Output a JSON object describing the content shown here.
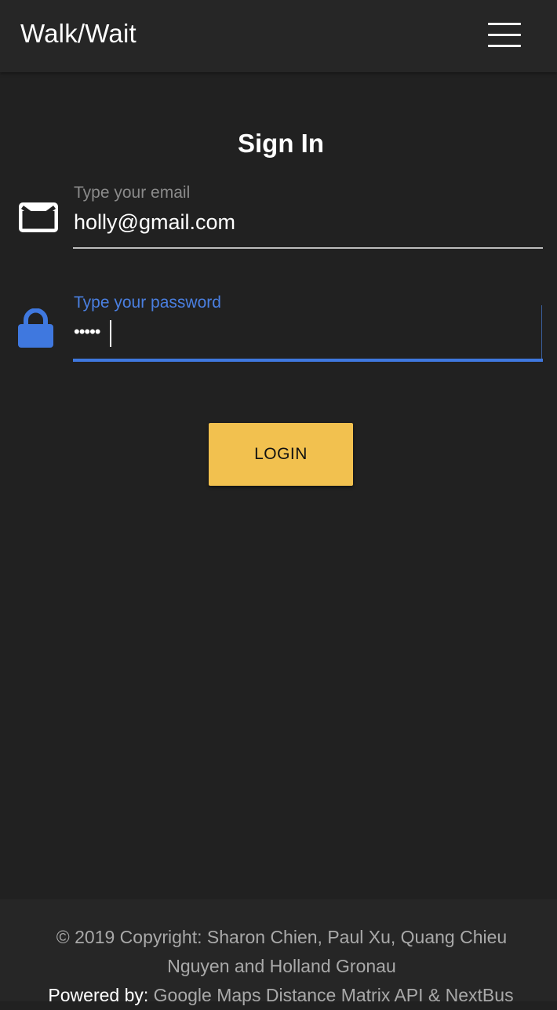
{
  "header": {
    "app_title": "Walk/Wait",
    "menu_icon": "hamburger-menu-icon"
  },
  "form": {
    "heading": "Sign In",
    "email": {
      "icon": "envelope-icon",
      "label": "Type your email",
      "value": "holly@gmail.com"
    },
    "password": {
      "icon": "lock-icon",
      "label": "Type your password",
      "masked_value": "•••••",
      "focused": true
    },
    "login_label": "LOGIN"
  },
  "footer": {
    "copyright": "© 2019 Copyright: Sharon Chien, Paul Xu, Quang Chieu Nguyen and Holland Gronau",
    "powered_label": "Powered by:",
    "powered_link": "Google Maps Distance Matrix API & NextBus"
  },
  "colors": {
    "background": "#212121",
    "bar": "#262626",
    "accent_blue": "#3f78df",
    "button_yellow": "#f2c14f"
  }
}
